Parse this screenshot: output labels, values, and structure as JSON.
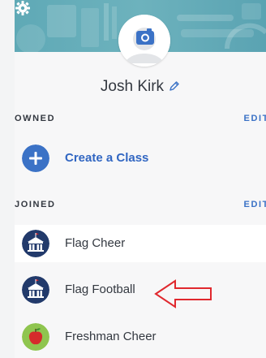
{
  "profile": {
    "name": "Josh Kirk"
  },
  "owned": {
    "title": "OWNED",
    "edit_label": "EDIT",
    "create_label": "Create a Class"
  },
  "joined": {
    "title": "JOINED",
    "edit_label": "EDIT",
    "classes": [
      {
        "label": "Flag Cheer",
        "icon": "school-building-icon"
      },
      {
        "label": "Flag Football",
        "icon": "school-building-icon"
      },
      {
        "label": "Freshman Cheer",
        "icon": "apple-icon"
      }
    ]
  },
  "colors": {
    "accent_blue": "#3b72c6",
    "school_icon_bg": "#223a6b",
    "arrow_red": "#e0282e",
    "banner_teal": "#5fa9b6"
  }
}
